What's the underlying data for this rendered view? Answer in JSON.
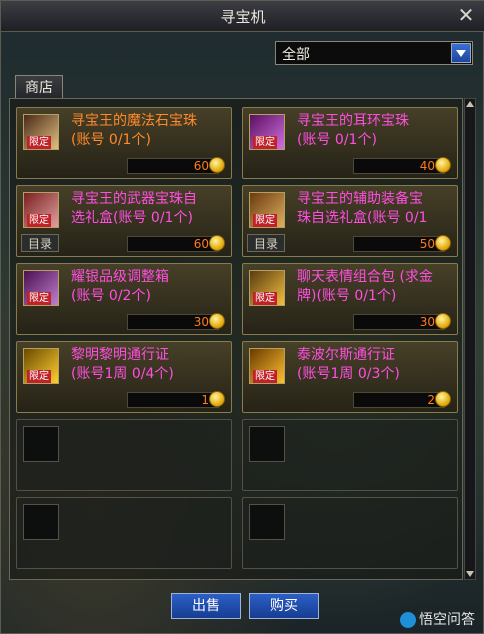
{
  "window": {
    "title": "寻宝机"
  },
  "filter": {
    "selected": "全部"
  },
  "tab": {
    "label": "商店"
  },
  "items": [
    {
      "name": "寻宝王的魔法石宝珠",
      "sub": "(账号 0/1个)",
      "price": "60",
      "badge": "限定",
      "color": "orange",
      "catalog": ""
    },
    {
      "name": "寻宝王的耳环宝珠",
      "sub": "(账号 0/1个)",
      "price": "40",
      "badge": "限定",
      "color": "pink",
      "catalog": ""
    },
    {
      "name": "寻宝王的武器宝珠自",
      "sub": "选礼盒(账号 0/1个)",
      "price": "60",
      "badge": "限定",
      "color": "pink",
      "catalog": "目录"
    },
    {
      "name": "寻宝王的辅助装备宝",
      "sub": "珠自选礼盒(账号 0/1",
      "price": "50",
      "badge": "限定",
      "color": "pink",
      "catalog": "目录"
    },
    {
      "name": "耀银品级调整箱",
      "sub": "(账号 0/2个)",
      "price": "30",
      "badge": "限定",
      "color": "pink",
      "catalog": ""
    },
    {
      "name": "聊天表情组合包 (求金",
      "sub": "牌)(账号 0/1个)",
      "price": "30",
      "badge": "限定",
      "color": "pink",
      "catalog": ""
    },
    {
      "name": "黎明黎明通行证",
      "sub": "(账号1周 0/4个)",
      "price": "1",
      "badge": "限定",
      "color": "pink",
      "catalog": ""
    },
    {
      "name": "泰波尔斯通行证",
      "sub": "(账号1周 0/3个)",
      "price": "2",
      "badge": "限定",
      "color": "pink",
      "catalog": ""
    }
  ],
  "buttons": {
    "sell": "出售",
    "buy": "购买"
  },
  "watermark": "悟空问答"
}
